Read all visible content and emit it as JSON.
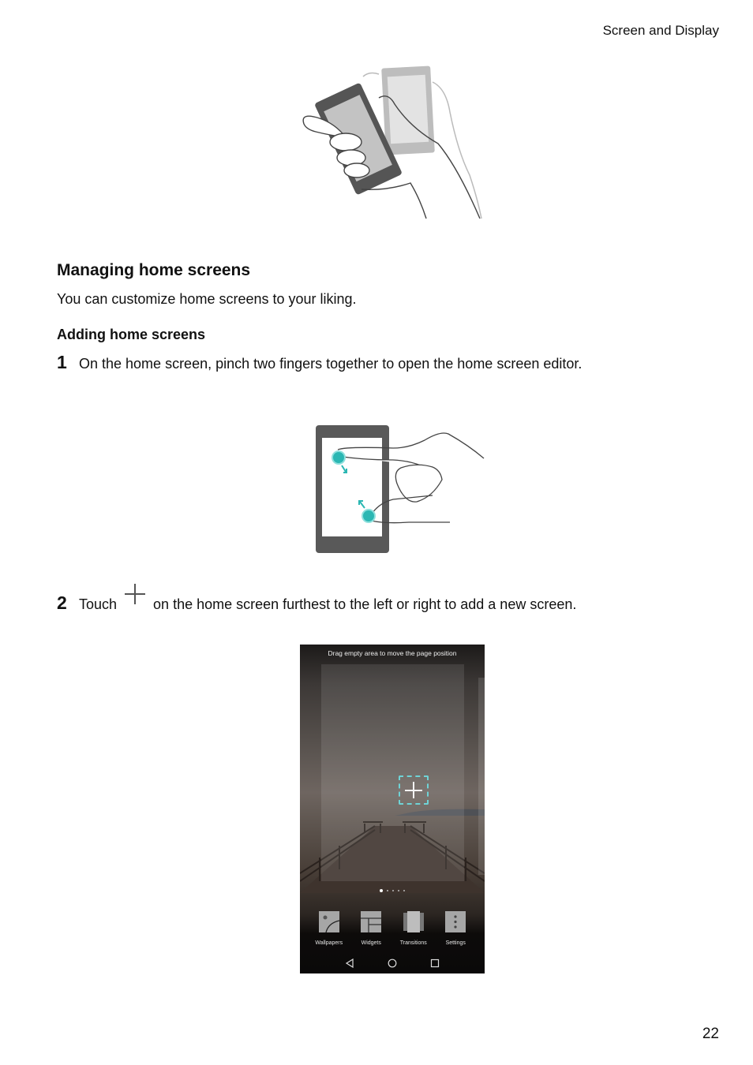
{
  "header": {
    "section_title": "Screen and Display"
  },
  "section": {
    "title": "Managing home screens",
    "intro": "You can customize home screens to your liking.",
    "subsection_title": "Adding home screens"
  },
  "steps": [
    {
      "number": "1",
      "text": "On the home screen, pinch two fingers together to open the home screen editor."
    },
    {
      "number": "2",
      "text_before": "Touch",
      "icon": "plus-icon",
      "text_after": "on the home screen furthest to the left or right to add a new screen."
    }
  ],
  "illustrations": {
    "tilt_phone": "hand-tilting-phone",
    "pinch": "pinch-gesture",
    "accent_color": "#2bb7b3"
  },
  "editor_screenshot": {
    "hint": "Drag empty area to move the page position",
    "add_page_icon": "plus-icon",
    "page_indicator": {
      "count": 5,
      "active_index": 0
    },
    "tools": [
      {
        "label": "Wallpapers",
        "icon": "wallpaper-icon"
      },
      {
        "label": "Widgets",
        "icon": "widgets-icon"
      },
      {
        "label": "Transitions",
        "icon": "transitions-icon"
      },
      {
        "label": "Settings",
        "icon": "settings-more-icon"
      }
    ],
    "nav": [
      "back-icon",
      "home-icon",
      "recents-icon"
    ],
    "dash_color": "#6fd3d6"
  },
  "footer": {
    "page_number": "22"
  }
}
